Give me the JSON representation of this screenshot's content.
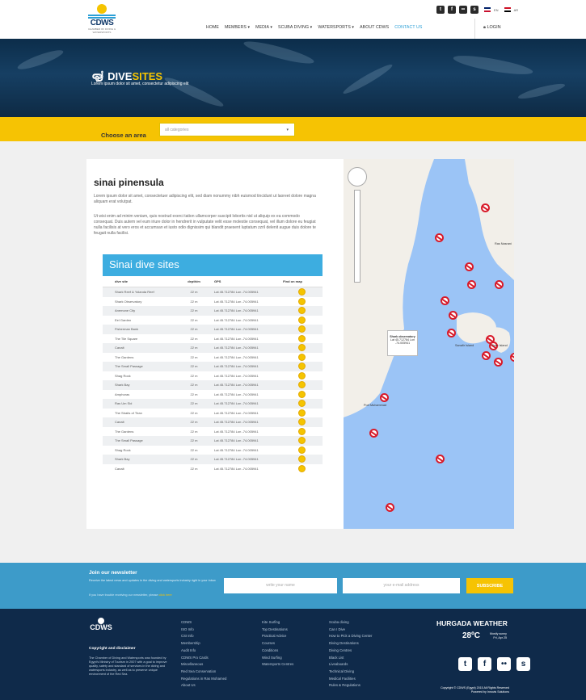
{
  "brand": {
    "logo_text": "CDWS",
    "logo_sub": "CHAMBER OF DIVING & WATERSPORTS"
  },
  "header": {
    "social": [
      "t",
      "f",
      "••",
      "s"
    ],
    "langs": [
      "EN",
      "AR"
    ],
    "nav": [
      "HOME",
      "MEMBERS ▾",
      "MEDIA ▾",
      "SCUBA DIVING ▾",
      "WATERSPORTS ▾",
      "ABOUT CDWS",
      "CONTACT US"
    ],
    "login": "LOGIN"
  },
  "banner": {
    "title_a": "DIVE",
    "title_b": "SITES",
    "subtitle": "Lorem ipsum dolor sit amet, consectetur adipiscing elit"
  },
  "filter": {
    "label": "Choose an area",
    "placeholder": "all categories",
    "chevron": "▾"
  },
  "region": {
    "title": "sinai pinensula",
    "para1": "Lorem ipsum dolor sit amet, consectetuer adipiscing elit, sed diam nonummy nibh euismod tincidunt ut laoreet dolore magna aliquam erat volutpat.",
    "para2": "Ut wisi enim ad minim veniam, quis nostrud exerci tation ullamcorper suscipit lobortis nisl ut aliquip ex ea commodo consequat. Duis autem vel eum iriure dolor in hendrerit in vulputate velit esse molestie consequat, vel illum dolore eu feugiat nulla facilisis at vero eros et accumsan et iusto odio dignissim qui blandit praesent luptatum zzril delenit augue duis dolore te feugait nulla facilisi."
  },
  "table": {
    "title": "Sinai dive sites",
    "columns": [
      "dive site",
      "depth/m",
      "GPS",
      "Find on map"
    ],
    "gps": "Lat 45.712784  Lon -74.005941",
    "depth": "22 m",
    "rows": [
      "Shark Reef & Yolanda Reef",
      "Shark Observatory",
      "Anemone City",
      "Eel Garden",
      "Fisherman Bank",
      "The Tile Square",
      "Canalt",
      "The Gardens",
      "The Small Passage",
      "Shag Rock",
      "Shark Bay",
      "Amphoras",
      "Ras Um Sid",
      "The Straits of Tiran",
      "Canalt",
      "The Gardens",
      "The Small Passage",
      "Shag Rock",
      "Shark Bay",
      "Canalt"
    ]
  },
  "map": {
    "info_title": "Shark observatory",
    "info_gps": "Lat 45.712784 Lon -74.005941",
    "labels": [
      "Ras Nasrani",
      "Sanafir Island",
      "Tiran Island",
      "Port Muhammad"
    ]
  },
  "newsletter": {
    "title": "Join our newsletter",
    "desc": "Receive the latest news and updates in the diving and watersports industry right in your inbox",
    "note": "If you have trouble receiving our newsletter, please",
    "note_link": "click here",
    "name_placeholder": "write your name",
    "email_placeholder": "your e-mail address",
    "button": "SUBSCRIBE"
  },
  "footer": {
    "copy_title": "Copyright and disclaimer",
    "copy_text": "The Chamber of Diving and Watersports was founded by Egypt's Ministry of Tourism in 2007 with a goal to improve quality, safety and standard of services in the diving and watersports industry, as well as to preserve unique environment of the Red Sea.",
    "col1": [
      "CDWS",
      "ISO Info",
      "CSI Info",
      "Membership",
      "Audit Info",
      "CDWS Pro Cards",
      "Miscellaneous",
      "Red Sea Conservation",
      "Regulations in Ras Mohamed",
      "About Us"
    ],
    "col2": [
      "Kite Surfing",
      "Top Destinations",
      "Practical Advice",
      "Courses",
      "Conditions",
      "Wind Surfing",
      "Watersports Centres"
    ],
    "col3": [
      "Scuba diving",
      "Can I Dive",
      "How to Pick a Diving Center",
      "Diving Destinations",
      "Diving Centres",
      "Black List",
      "Liveaboards",
      "Technical Diving",
      "Medical Facilities",
      "Rules & Regulations"
    ],
    "weather_title": "HURGADA WEATHER",
    "temperature": "28ºC",
    "weather_desc1": "Mostly sunny",
    "weather_desc2": "Fri, Apr 25",
    "social": [
      "t",
      "f",
      "••",
      "s"
    ],
    "copyright1": "Copyright © CDWS (Egypt) 2015 All Rights Reserved",
    "copyright2": "Powered by Innovis Solutions"
  }
}
